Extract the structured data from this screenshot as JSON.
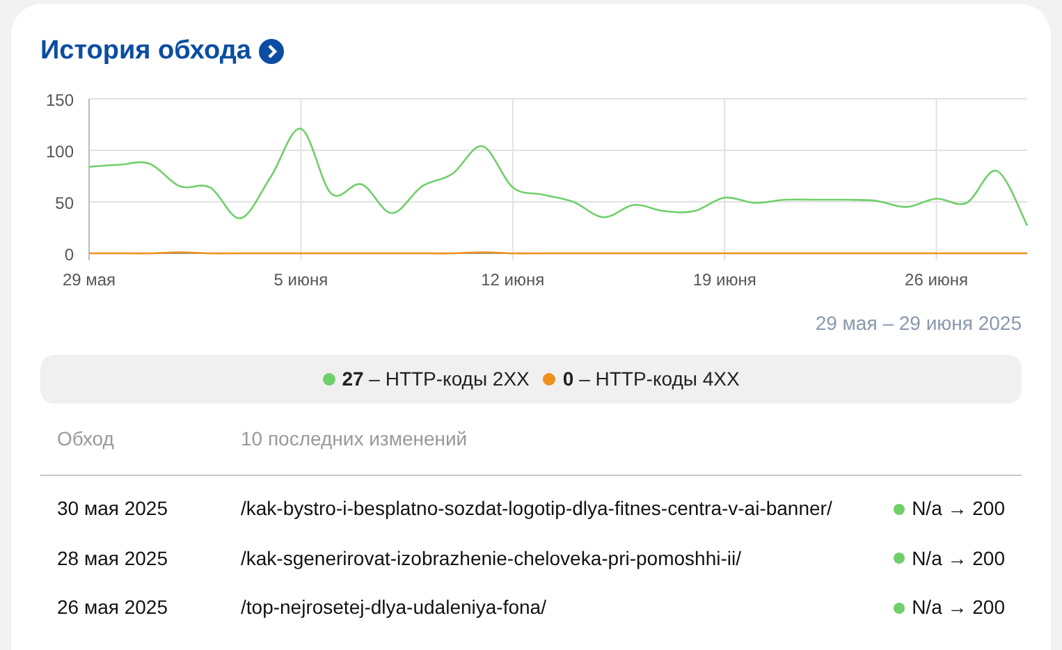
{
  "title": "История обхода",
  "chart_data": {
    "type": "line",
    "grid": true,
    "categories": [
      "29 мая",
      null,
      null,
      null,
      null,
      null,
      null,
      "5 июня",
      null,
      null,
      null,
      null,
      null,
      null,
      "12 июня",
      null,
      null,
      null,
      null,
      null,
      null,
      "19 июня",
      null,
      null,
      null,
      null,
      null,
      null,
      "26 июня",
      null,
      null,
      null
    ],
    "series": [
      {
        "color": "#6fcf6a",
        "values": [
          84,
          86,
          87,
          65,
          64,
          34,
          74,
          121,
          58,
          67,
          39,
          65,
          77,
          104,
          64,
          57,
          50,
          35,
          47,
          41,
          41,
          54,
          49,
          52,
          52,
          52,
          51,
          45,
          53,
          49,
          80,
          27
        ]
      },
      {
        "color": "#f0901c",
        "values": [
          0,
          0,
          0,
          1,
          0,
          0,
          0,
          0,
          0,
          0,
          0,
          0,
          0,
          1,
          0,
          0,
          0,
          0,
          0,
          0,
          0,
          0,
          0,
          0,
          0,
          0,
          0,
          0,
          0,
          0,
          0,
          0
        ]
      }
    ],
    "ylim": [
      0,
      150
    ],
    "yticks": [
      0,
      50,
      100,
      150
    ]
  },
  "date_range": "29 мая – 29 июня 2025",
  "legend": [
    {
      "text": "**27** – HTTP-коды 2XX",
      "color": "#6fcf6a"
    },
    {
      "text": "**0** – HTTP-коды 4XX",
      "color": "#f0901c"
    }
  ],
  "table": {
    "columns": [
      "Обход",
      "10 последних изменений"
    ],
    "rows": [
      {
        "date": "30 мая 2025",
        "url": "/kak-bystro-i-besplatno-sozdat-logotip-dlya-fitnes-centra-v-ai-banner/",
        "status": "N/a → 200",
        "color": "#6fcf6a"
      },
      {
        "date": "28 мая 2025",
        "url": "/kak-sgenerirovat-izobrazhenie-cheloveka-pri-pomoshhi-ii/",
        "status": "N/a → 200",
        "color": "#6fcf6a"
      },
      {
        "date": "26 мая 2025",
        "url": "/top-nejrosetej-dlya-udaleniya-fona/",
        "status": "N/a → 200",
        "color": "#6fcf6a"
      }
    ]
  }
}
